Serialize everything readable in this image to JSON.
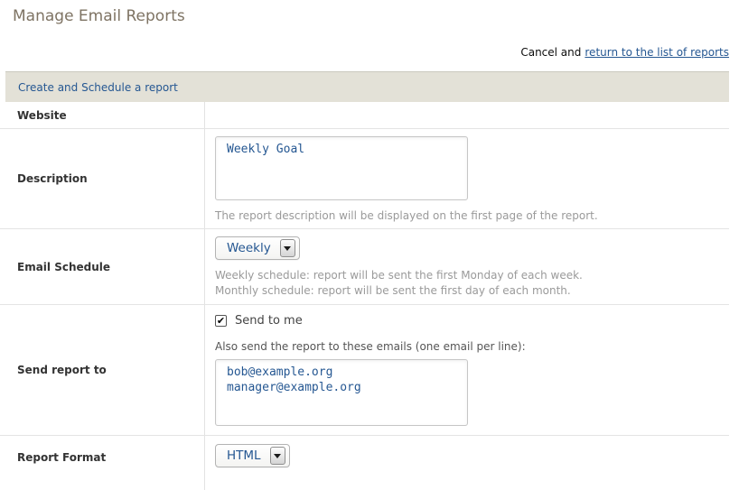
{
  "page": {
    "title": "Manage Email Reports",
    "cancel_prefix": "Cancel and",
    "cancel_link": "return to the list of reports"
  },
  "panel": {
    "header": "Create and Schedule a report"
  },
  "form": {
    "website": {
      "label": "Website",
      "value": ""
    },
    "description": {
      "label": "Description",
      "value": "Weekly Goal",
      "help": "The report description will be displayed on the first page of the report."
    },
    "schedule": {
      "label": "Email Schedule",
      "selected": "Weekly",
      "help_line1": "Weekly schedule: report will be sent the first Monday of each week.",
      "help_line2": "Monthly schedule: report will be sent the first day of each month."
    },
    "recipients": {
      "label": "Send report to",
      "send_to_me_label": "Send to me",
      "send_to_me_checked": true,
      "checkbox_glyph": "✔",
      "also_send_label": "Also send the report to these emails (one email per line):",
      "emails": "bob@example.org\nmanager@example.org"
    },
    "format": {
      "label": "Report Format",
      "selected": "HTML"
    }
  },
  "colors": {
    "accent_blue": "#255792",
    "panel_header_bg": "#E3E1D7",
    "title_color": "#7E7363",
    "help_text": "#9A9A9A"
  }
}
